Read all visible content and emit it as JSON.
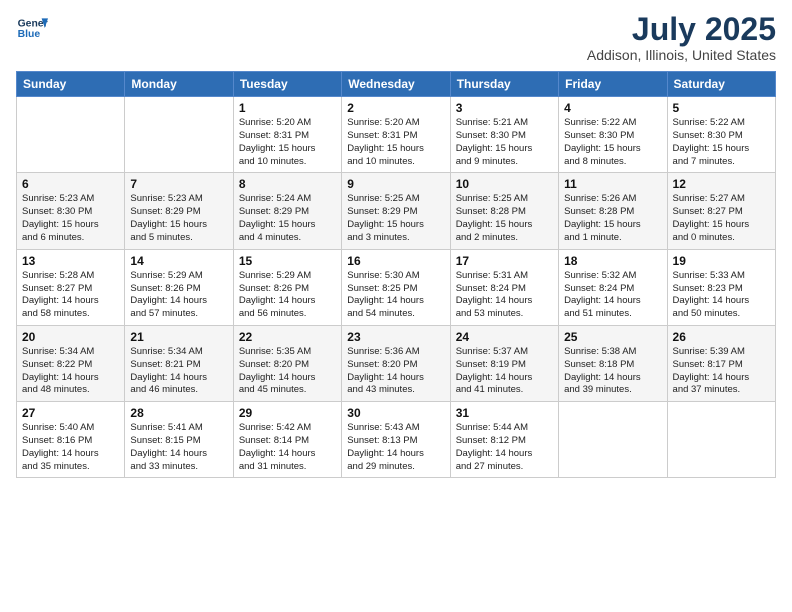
{
  "header": {
    "logo_line1": "General",
    "logo_line2": "Blue",
    "title": "July 2025",
    "subtitle": "Addison, Illinois, United States"
  },
  "weekdays": [
    "Sunday",
    "Monday",
    "Tuesday",
    "Wednesday",
    "Thursday",
    "Friday",
    "Saturday"
  ],
  "weeks": [
    [
      {
        "day": "",
        "info": ""
      },
      {
        "day": "",
        "info": ""
      },
      {
        "day": "1",
        "info": "Sunrise: 5:20 AM\nSunset: 8:31 PM\nDaylight: 15 hours\nand 10 minutes."
      },
      {
        "day": "2",
        "info": "Sunrise: 5:20 AM\nSunset: 8:31 PM\nDaylight: 15 hours\nand 10 minutes."
      },
      {
        "day": "3",
        "info": "Sunrise: 5:21 AM\nSunset: 8:30 PM\nDaylight: 15 hours\nand 9 minutes."
      },
      {
        "day": "4",
        "info": "Sunrise: 5:22 AM\nSunset: 8:30 PM\nDaylight: 15 hours\nand 8 minutes."
      },
      {
        "day": "5",
        "info": "Sunrise: 5:22 AM\nSunset: 8:30 PM\nDaylight: 15 hours\nand 7 minutes."
      }
    ],
    [
      {
        "day": "6",
        "info": "Sunrise: 5:23 AM\nSunset: 8:30 PM\nDaylight: 15 hours\nand 6 minutes."
      },
      {
        "day": "7",
        "info": "Sunrise: 5:23 AM\nSunset: 8:29 PM\nDaylight: 15 hours\nand 5 minutes."
      },
      {
        "day": "8",
        "info": "Sunrise: 5:24 AM\nSunset: 8:29 PM\nDaylight: 15 hours\nand 4 minutes."
      },
      {
        "day": "9",
        "info": "Sunrise: 5:25 AM\nSunset: 8:29 PM\nDaylight: 15 hours\nand 3 minutes."
      },
      {
        "day": "10",
        "info": "Sunrise: 5:25 AM\nSunset: 8:28 PM\nDaylight: 15 hours\nand 2 minutes."
      },
      {
        "day": "11",
        "info": "Sunrise: 5:26 AM\nSunset: 8:28 PM\nDaylight: 15 hours\nand 1 minute."
      },
      {
        "day": "12",
        "info": "Sunrise: 5:27 AM\nSunset: 8:27 PM\nDaylight: 15 hours\nand 0 minutes."
      }
    ],
    [
      {
        "day": "13",
        "info": "Sunrise: 5:28 AM\nSunset: 8:27 PM\nDaylight: 14 hours\nand 58 minutes."
      },
      {
        "day": "14",
        "info": "Sunrise: 5:29 AM\nSunset: 8:26 PM\nDaylight: 14 hours\nand 57 minutes."
      },
      {
        "day": "15",
        "info": "Sunrise: 5:29 AM\nSunset: 8:26 PM\nDaylight: 14 hours\nand 56 minutes."
      },
      {
        "day": "16",
        "info": "Sunrise: 5:30 AM\nSunset: 8:25 PM\nDaylight: 14 hours\nand 54 minutes."
      },
      {
        "day": "17",
        "info": "Sunrise: 5:31 AM\nSunset: 8:24 PM\nDaylight: 14 hours\nand 53 minutes."
      },
      {
        "day": "18",
        "info": "Sunrise: 5:32 AM\nSunset: 8:24 PM\nDaylight: 14 hours\nand 51 minutes."
      },
      {
        "day": "19",
        "info": "Sunrise: 5:33 AM\nSunset: 8:23 PM\nDaylight: 14 hours\nand 50 minutes."
      }
    ],
    [
      {
        "day": "20",
        "info": "Sunrise: 5:34 AM\nSunset: 8:22 PM\nDaylight: 14 hours\nand 48 minutes."
      },
      {
        "day": "21",
        "info": "Sunrise: 5:34 AM\nSunset: 8:21 PM\nDaylight: 14 hours\nand 46 minutes."
      },
      {
        "day": "22",
        "info": "Sunrise: 5:35 AM\nSunset: 8:20 PM\nDaylight: 14 hours\nand 45 minutes."
      },
      {
        "day": "23",
        "info": "Sunrise: 5:36 AM\nSunset: 8:20 PM\nDaylight: 14 hours\nand 43 minutes."
      },
      {
        "day": "24",
        "info": "Sunrise: 5:37 AM\nSunset: 8:19 PM\nDaylight: 14 hours\nand 41 minutes."
      },
      {
        "day": "25",
        "info": "Sunrise: 5:38 AM\nSunset: 8:18 PM\nDaylight: 14 hours\nand 39 minutes."
      },
      {
        "day": "26",
        "info": "Sunrise: 5:39 AM\nSunset: 8:17 PM\nDaylight: 14 hours\nand 37 minutes."
      }
    ],
    [
      {
        "day": "27",
        "info": "Sunrise: 5:40 AM\nSunset: 8:16 PM\nDaylight: 14 hours\nand 35 minutes."
      },
      {
        "day": "28",
        "info": "Sunrise: 5:41 AM\nSunset: 8:15 PM\nDaylight: 14 hours\nand 33 minutes."
      },
      {
        "day": "29",
        "info": "Sunrise: 5:42 AM\nSunset: 8:14 PM\nDaylight: 14 hours\nand 31 minutes."
      },
      {
        "day": "30",
        "info": "Sunrise: 5:43 AM\nSunset: 8:13 PM\nDaylight: 14 hours\nand 29 minutes."
      },
      {
        "day": "31",
        "info": "Sunrise: 5:44 AM\nSunset: 8:12 PM\nDaylight: 14 hours\nand 27 minutes."
      },
      {
        "day": "",
        "info": ""
      },
      {
        "day": "",
        "info": ""
      }
    ]
  ]
}
